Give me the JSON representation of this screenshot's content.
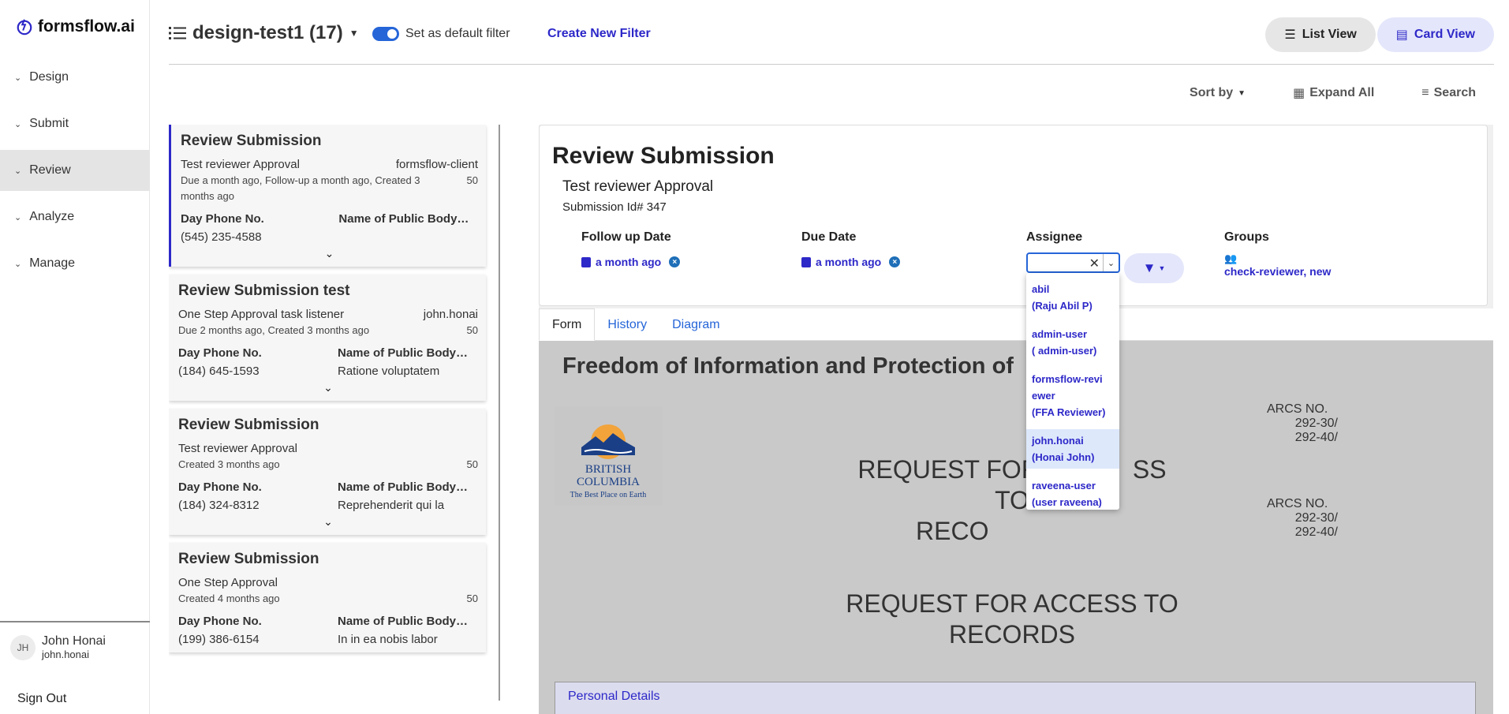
{
  "brand": {
    "name": "formsflow.ai"
  },
  "sidebar": {
    "items": [
      {
        "label": "Design"
      },
      {
        "label": "Submit"
      },
      {
        "label": "Review"
      },
      {
        "label": "Analyze"
      },
      {
        "label": "Manage"
      }
    ],
    "user": {
      "initials": "JH",
      "name": "John Honai",
      "username": "john.honai"
    },
    "sign_out": "Sign Out"
  },
  "topbar": {
    "filter_name": "design-test1 (17)",
    "default_filter_label": "Set as default filter",
    "create_filter": "Create New Filter",
    "list_view": "List View",
    "card_view": "Card View"
  },
  "toolbar": {
    "sort_by": "Sort by",
    "expand_all": "Expand All",
    "search": "Search"
  },
  "tasks": [
    {
      "title": "Review Submission",
      "process": "Test reviewer Approval",
      "assignee": "formsflow-client",
      "dates": "Due a month ago, Follow-up a month ago, Created 3 months ago",
      "priority": "50",
      "f1_label": "Day Phone No.",
      "f1_value": "(545) 235-4588",
      "f2_label": "Name of Public Body…",
      "f2_value": ""
    },
    {
      "title": "Review Submission test",
      "process": "One Step Approval task listener",
      "assignee": "john.honai",
      "dates": "Due 2 months ago, Created 3 months ago",
      "priority": "50",
      "f1_label": "Day Phone No.",
      "f1_value": "(184) 645-1593",
      "f2_label": "Name of Public Body…",
      "f2_value": "Ratione voluptatem"
    },
    {
      "title": "Review Submission",
      "process": "Test reviewer Approval",
      "assignee": "",
      "dates": "Created 3 months ago",
      "priority": "50",
      "f1_label": "Day Phone No.",
      "f1_value": "(184) 324-8312",
      "f2_label": "Name of Public Body…",
      "f2_value": "Reprehenderit qui la"
    },
    {
      "title": "Review Submission",
      "process": "One Step Approval",
      "assignee": "",
      "dates": "Created 4 months ago",
      "priority": "50",
      "f1_label": "Day Phone No.",
      "f1_value": "(199) 386-6154",
      "f2_label": "Name of Public Body…",
      "f2_value": "In in ea nobis labor"
    }
  ],
  "detail": {
    "title": "Review Submission",
    "process": "Test reviewer Approval",
    "submission_id": "Submission Id# 347",
    "follow_up_label": "Follow up Date",
    "follow_up_value": "a month ago",
    "due_label": "Due Date",
    "due_value": "a month ago",
    "assignee_label": "Assignee",
    "groups_label": "Groups",
    "groups_value": "check-reviewer, new",
    "tabs": [
      {
        "label": "Form"
      },
      {
        "label": "History"
      },
      {
        "label": "Diagram"
      }
    ],
    "form": {
      "heading": "Freedom of Information and Protection of",
      "logo_line1": "BRITISH",
      "logo_line2": "COLUMBIA",
      "logo_tagline": "The Best Place on Earth",
      "arcs_label": "ARCS NO.",
      "arcs_1": "292-30/",
      "arcs_2": "292-40/",
      "request_title_partial_1": "REQUEST FOR",
      "request_title_partial_2": "SS TO",
      "request_title_partial_3": "RECO",
      "request_title_1": "REQUEST FOR ACCESS TO",
      "request_title_2": "RECORDS",
      "section": "Personal Details"
    }
  },
  "assignee_dropdown": [
    {
      "line1": "abil",
      "line2": "(Raju Abil P)"
    },
    {
      "line1": "admin-user",
      "line2": "( admin-user)"
    },
    {
      "line1": "formsflow-revi",
      "line1b": "ewer",
      "line2": "(FFA Reviewer)"
    },
    {
      "line1": "john.honai",
      "line2": "(Honai John)"
    },
    {
      "line1": "raveena-user",
      "line2": "(user raveena)"
    }
  ],
  "colors": {
    "accent": "#2d28c8",
    "toggle": "#2565d8",
    "highlight": "#dde8fb"
  }
}
